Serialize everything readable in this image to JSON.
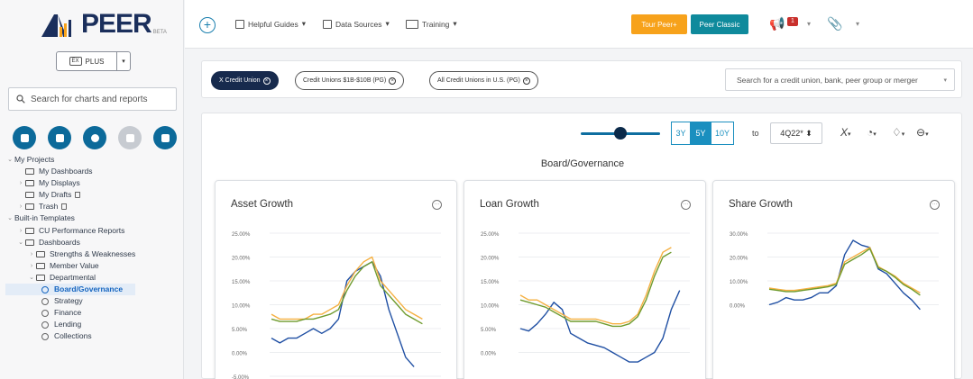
{
  "app": {
    "logo_text": "PEER",
    "logo_beta": "BETA"
  },
  "sidebar": {
    "plus_label": "PLUS",
    "search_placeholder": "Search for charts and reports",
    "tree": [
      {
        "label": "My Projects",
        "level": 0,
        "kind": "section",
        "caret": "down"
      },
      {
        "label": "My Dashboards",
        "level": 1,
        "kind": "folder",
        "caret": ""
      },
      {
        "label": "My Displays",
        "level": 1,
        "kind": "folder",
        "caret": "right"
      },
      {
        "label": "My Drafts",
        "level": 1,
        "kind": "folder",
        "caret": "",
        "trash_icon": true
      },
      {
        "label": "Trash",
        "level": 1,
        "kind": "folder",
        "caret": "right",
        "trash_icon": true
      },
      {
        "label": "Built-in Templates",
        "level": 0,
        "kind": "section",
        "caret": "down"
      },
      {
        "label": "CU Performance Reports",
        "level": 1,
        "kind": "folder",
        "caret": "right"
      },
      {
        "label": "Dashboards",
        "level": 1,
        "kind": "folder",
        "caret": "down"
      },
      {
        "label": "Strengths & Weaknesses",
        "level": 2,
        "kind": "folder",
        "caret": "right"
      },
      {
        "label": "Member Value",
        "level": 2,
        "kind": "folder",
        "caret": "right"
      },
      {
        "label": "Departmental",
        "level": 2,
        "kind": "folder",
        "caret": "down"
      },
      {
        "label": "Board/Governance",
        "level": 3,
        "kind": "template",
        "active": true
      },
      {
        "label": "Strategy",
        "level": 3,
        "kind": "template"
      },
      {
        "label": "Finance",
        "level": 3,
        "kind": "template"
      },
      {
        "label": "Lending",
        "level": 3,
        "kind": "template"
      },
      {
        "label": "Collections",
        "level": 3,
        "kind": "template"
      }
    ]
  },
  "topbar": {
    "helpful_guides": "Helpful Guides",
    "data_sources": "Data Sources",
    "training": "Training",
    "tour_button": "Tour Peer+",
    "classic_button": "Peer Classic",
    "notification_count": "1"
  },
  "filters": {
    "pills": [
      "X Credit Union",
      "Credit Unions $1B-$10B (PG)",
      "All Credit Unions in U.S. (PG)"
    ],
    "search_placeholder": "Search for a credit union, bank, peer group or merger"
  },
  "toolbar": {
    "ranges": [
      "3Y",
      "5Y",
      "10Y"
    ],
    "selected_range": "5Y",
    "to_label": "to",
    "quarter": "4Q22*"
  },
  "dashboard": {
    "title": "Board/Governance"
  },
  "colors": {
    "series_blue": "#1f4fa3",
    "series_orange": "#f5b041",
    "series_green": "#6f9b2e",
    "accent": "#1a8fbf"
  },
  "chart_data": [
    {
      "type": "line",
      "title": "Asset Growth",
      "ylabels": [
        "25.00%",
        "20.00%",
        "15.00%",
        "10.00%",
        "5.00%",
        "0.00%",
        "-5.00%"
      ],
      "ylim": [
        -5,
        25
      ],
      "x": [
        1,
        2,
        3,
        4,
        5,
        6,
        7,
        8,
        9,
        10,
        11,
        12,
        13,
        14,
        15,
        16,
        17,
        18,
        19,
        20,
        21
      ],
      "series": [
        {
          "color": "#1f4fa3",
          "values": [
            3,
            2,
            3,
            3,
            4,
            5,
            4,
            5,
            7,
            15,
            17,
            18,
            19,
            16,
            9,
            4,
            -1,
            -3
          ]
        },
        {
          "color": "#f5b041",
          "values": [
            8,
            7,
            7,
            7,
            7,
            8,
            8,
            9,
            10,
            14,
            17,
            19,
            20,
            15,
            13,
            11,
            9,
            8,
            7
          ]
        },
        {
          "color": "#6f9b2e",
          "values": [
            7,
            6.5,
            6.5,
            6.5,
            7,
            7,
            7.5,
            8,
            9,
            13,
            16,
            18,
            19,
            14,
            12,
            10,
            8,
            7,
            6
          ]
        }
      ]
    },
    {
      "type": "line",
      "title": "Loan Growth",
      "ylabels": [
        "25.00%",
        "20.00%",
        "15.00%",
        "10.00%",
        "5.00%",
        "0.00%"
      ],
      "ylim": [
        -1,
        25
      ],
      "x": [
        1,
        2,
        3,
        4,
        5,
        6,
        7,
        8,
        9,
        10,
        11,
        12,
        13,
        14,
        15,
        16,
        17,
        18,
        19,
        20,
        21
      ],
      "series": [
        {
          "color": "#1f4fa3",
          "values": [
            5,
            4.5,
            6,
            8,
            10.5,
            9,
            4,
            3,
            2,
            1.5,
            1,
            0,
            -1,
            -2,
            -2,
            -1,
            0,
            3,
            9,
            13
          ]
        },
        {
          "color": "#f5b041",
          "values": [
            12,
            11,
            11,
            10,
            9,
            8,
            7,
            7,
            7,
            7,
            6.5,
            6,
            6,
            6.5,
            8,
            12,
            17,
            21,
            22
          ]
        },
        {
          "color": "#6f9b2e",
          "values": [
            11,
            10.5,
            10,
            9.5,
            8.5,
            7.5,
            6.5,
            6.5,
            6.5,
            6.5,
            6,
            5.5,
            5.5,
            6,
            7.5,
            11,
            16,
            20,
            21
          ]
        }
      ]
    },
    {
      "type": "line",
      "title": "Share Growth",
      "ylabels": [
        "30.00%",
        "20.00%",
        "10.00%",
        "0.00%"
      ],
      "ylim": [
        -3,
        30
      ],
      "x": [
        1,
        2,
        3,
        4,
        5,
        6,
        7,
        8,
        9,
        10,
        11,
        12,
        13,
        14,
        15,
        16,
        17,
        18,
        19,
        20,
        21
      ],
      "series": [
        {
          "color": "#1f4fa3",
          "values": [
            0,
            1,
            3,
            2,
            2,
            3,
            5,
            5,
            8,
            21,
            27,
            25,
            24,
            15,
            13,
            9,
            5,
            2,
            -2
          ]
        },
        {
          "color": "#f5b041",
          "values": [
            7,
            6.5,
            6,
            6,
            6.5,
            7,
            7.5,
            8,
            9,
            18,
            20,
            22,
            24,
            16,
            14,
            12,
            9,
            7,
            5
          ]
        },
        {
          "color": "#6f9b2e",
          "values": [
            6.5,
            6,
            5.5,
            5.5,
            6,
            6.5,
            7,
            7.5,
            8.5,
            17,
            19,
            21,
            23.5,
            15.5,
            14,
            11.5,
            8.5,
            6.5,
            4
          ]
        }
      ]
    }
  ]
}
